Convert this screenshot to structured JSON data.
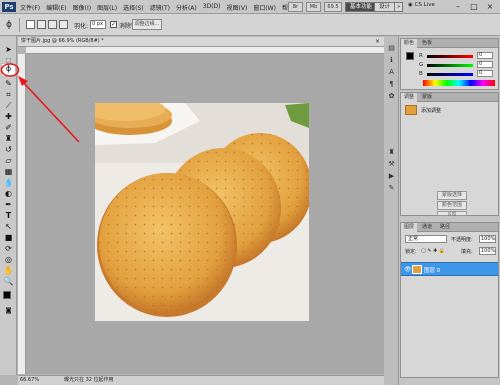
{
  "app": {
    "logo": "Ps",
    "menus": [
      "文件(F)",
      "编辑(E)",
      "图像(I)",
      "图层(L)",
      "选择(S)",
      "滤镜(T)",
      "分析(A)",
      "3D(D)",
      "视图(V)",
      "窗口(W)",
      "帮助(H)"
    ],
    "zoom_box": "69.5",
    "workspace_active": "基本功能",
    "workspace_design": "设计",
    "workspace_more": "»",
    "cs_live": "CS Live",
    "win_minimize": "–",
    "win_restore": "□",
    "win_close": "×"
  },
  "options": {
    "feather_label": "羽化:",
    "feather_value": "0 px",
    "antialias_label": "消除锯齿",
    "refine_edge_label": "调整边缘..."
  },
  "document": {
    "tab_title": "饼干图片.jpg @ 66.9% (RGB/8#) *",
    "tab_close": "×"
  },
  "status": {
    "zoom": "66.67%",
    "doc_info": "曝光只在 32 位起作用"
  },
  "color_panel": {
    "tab_color": "颜色",
    "tab_swatches": "色板",
    "r_label": "R",
    "g_label": "G",
    "b_label": "B",
    "r_value": "0",
    "g_value": "0",
    "b_value": "0"
  },
  "adjust_panel": {
    "tab_adjust": "调整",
    "tab_masks": "蒙版",
    "preset_label": "添加调整",
    "button_1": "蒙版选择",
    "button_2": "颜色范围",
    "button_3": "反相"
  },
  "layers_panel": {
    "tab_layers": "图层",
    "tab_channels": "通道",
    "tab_paths": "路径",
    "blend_mode": "正常",
    "opacity_label": "不透明度:",
    "opacity_value": "100%",
    "lock_label": "锁定:",
    "fill_label": "填充:",
    "fill_value": "100%",
    "layer_name": "图层 0"
  },
  "colors": {
    "accent_blue": "#3d97e8",
    "callout_red": "#e8191c",
    "workspace_dark": "#4a4a4a"
  }
}
